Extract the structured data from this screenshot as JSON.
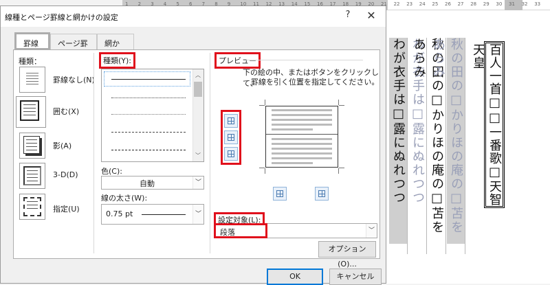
{
  "ruler": {
    "ticks": [
      "1",
      "2",
      "3",
      "4",
      "5",
      "6",
      "7",
      "8",
      "9",
      "10",
      "11",
      "12",
      "13",
      "14",
      "15",
      "16",
      "17",
      "18",
      "19",
      "20",
      "21",
      "22",
      "23",
      "24",
      "25",
      "26",
      "27",
      "28",
      "29",
      "30",
      "31",
      "32",
      "33"
    ]
  },
  "document": {
    "columns": [
      {
        "text": "わが衣手は□露にぬれつつ",
        "style": "black",
        "shaded": true
      },
      {
        "text": "わが衣手は□露にぬれつつ",
        "style": "gray",
        "shaded": false
      },
      {
        "text": "秋の田の□かりほの庵の□苫をあらみ",
        "style": "black",
        "shaded": false
      },
      {
        "text": "秋の田の□かりほの庵の□苫をあらみ",
        "style": "gray",
        "shaded": true
      }
    ],
    "title_box": "百人一首□□一番歌□天智天皇"
  },
  "dialog": {
    "title": "線種とページ罫線と網かけの設定",
    "help": "?",
    "close": "✕",
    "tabs": [
      "罫線",
      "ページ罫線",
      "網かけ"
    ],
    "setting": {
      "label": "種類：",
      "items": [
        {
          "label": "罫線なし(N)",
          "icon": "border-none-icon"
        },
        {
          "label": "囲む(X)",
          "icon": "border-box-icon",
          "selected": true
        },
        {
          "label": "影(A)",
          "icon": "border-shadow-icon"
        },
        {
          "label": "3-D(D)",
          "icon": "border-3d-icon"
        },
        {
          "label": "指定(U)",
          "icon": "border-custom-icon"
        }
      ]
    },
    "style": {
      "label": "種類(Y):",
      "line_styles": [
        "solid",
        "dotted",
        "dotted-fine",
        "dashed",
        "dash-dot"
      ],
      "color_label": "色(C):",
      "color_value": "自動",
      "width_label": "線の太さ(W):",
      "width_value": "0.75 pt"
    },
    "preview": {
      "label": "プレビュー",
      "instruction_line1": "下の絵の中、またはボタンをクリックして、",
      "instruction_line2": "罫線を引く位置を指定してください。",
      "apply_label": "設定対象(L):",
      "apply_value": "段落",
      "options_button": "オプション(O)..."
    },
    "ok": "OK",
    "cancel": "キャンセル"
  },
  "colors": {
    "highlight": "#e0101c",
    "accent": "#0078d7"
  }
}
